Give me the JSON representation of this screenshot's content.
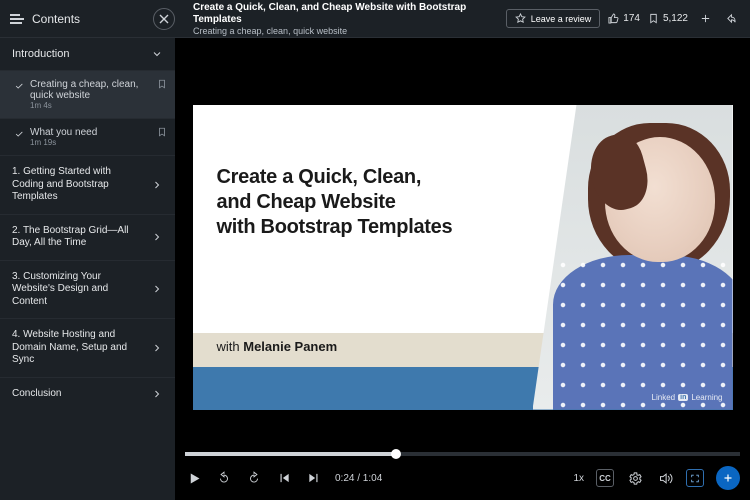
{
  "header": {
    "contents_label": "Contents",
    "title": "Create a Quick, Clean, and Cheap Website with Bootstrap Templates",
    "subtitle": "Creating a cheap, clean, quick website",
    "review_label": "Leave a review",
    "likes": "174",
    "saves": "5,122"
  },
  "sidebar": {
    "intro_label": "Introduction",
    "lessons": [
      {
        "title": "Creating a cheap, clean, quick website",
        "duration": "1m 4s"
      },
      {
        "title": "What you need",
        "duration": "1m 19s"
      }
    ],
    "chapters": [
      "1. Getting Started with Coding and Bootstrap Templates",
      "2. The Bootstrap Grid—All Day, All the Time",
      "3. Customizing Your Website's Design and Content",
      "4. Website Hosting and Domain Name, Setup and Sync",
      "Conclusion"
    ]
  },
  "slide": {
    "title_l1": "Create a Quick, Clean,",
    "title_l2": "and Cheap Website",
    "title_l3": "with Bootstrap Templates",
    "with_prefix": "with ",
    "instructor": "Melanie Panem",
    "brand_a": "Linked",
    "brand_b": "in",
    "brand_c": "Learning"
  },
  "player": {
    "time": "0:24 / 1:04",
    "speed": "1x",
    "cc": "CC"
  }
}
